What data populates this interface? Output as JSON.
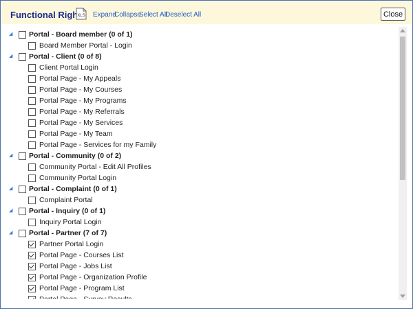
{
  "header": {
    "title": "Functional Rights",
    "xls_label": "XLS",
    "expand": "Expand",
    "collapse": "Collapse",
    "select_all": "Select All",
    "deselect_all": "Deselect All",
    "close": "Close"
  },
  "groups": [
    {
      "label": "Portal - Board member (0 of 1)",
      "expanded": true,
      "items": [
        {
          "label": "Board Member Portal - Login",
          "checked": false
        }
      ]
    },
    {
      "label": "Portal - Client (0 of 8)",
      "expanded": true,
      "items": [
        {
          "label": "Client Portal Login",
          "checked": false
        },
        {
          "label": "Portal Page - My Appeals",
          "checked": false
        },
        {
          "label": "Portal Page - My Courses",
          "checked": false
        },
        {
          "label": "Portal Page - My Programs",
          "checked": false
        },
        {
          "label": "Portal Page - My Referrals",
          "checked": false
        },
        {
          "label": "Portal Page - My Services",
          "checked": false
        },
        {
          "label": "Portal Page - My Team",
          "checked": false
        },
        {
          "label": "Portal Page - Services for my Family",
          "checked": false
        }
      ]
    },
    {
      "label": "Portal - Community (0 of 2)",
      "expanded": true,
      "items": [
        {
          "label": "Community Portal - Edit All Profiles",
          "checked": false
        },
        {
          "label": "Community Portal Login",
          "checked": false
        }
      ]
    },
    {
      "label": "Portal - Complaint (0 of 1)",
      "expanded": true,
      "items": [
        {
          "label": "Complaint Portal",
          "checked": false
        }
      ]
    },
    {
      "label": "Portal - Inquiry (0 of 1)",
      "expanded": true,
      "items": [
        {
          "label": "Inquiry Portal Login",
          "checked": false
        }
      ]
    },
    {
      "label": "Portal - Partner (7 of 7)",
      "expanded": true,
      "items": [
        {
          "label": "Partner Portal Login",
          "checked": true
        },
        {
          "label": "Portal Page - Courses List",
          "checked": true
        },
        {
          "label": "Portal Page - Jobs List",
          "checked": true
        },
        {
          "label": "Portal Page - Organization Profile",
          "checked": true
        },
        {
          "label": "Portal Page - Program List",
          "checked": true
        },
        {
          "label": "Portal Page - Survey Results",
          "checked": true
        }
      ]
    }
  ],
  "colors": {
    "header_bg": "#fdf8dc",
    "title": "#1b2a8c",
    "link": "#1f5bc0",
    "expander": "#2a7fd4"
  },
  "icons": {
    "expander": "expanded-triangle-icon",
    "export": "xls-file-icon"
  },
  "scrollbar": {
    "position": 0.0,
    "visible_fraction": 0.53
  }
}
